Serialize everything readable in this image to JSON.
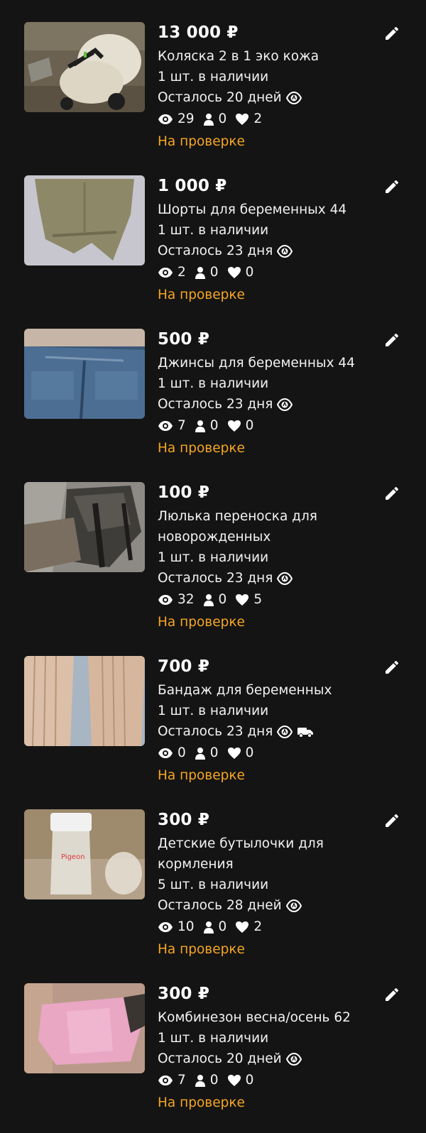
{
  "listings": [
    {
      "price": "13 000 ₽",
      "title": "Коляска 2 в 1 эко кожа",
      "title2": "",
      "stock": "1 шт. в наличии",
      "expires": "Осталось 20 дней",
      "views": "29",
      "contacts": "0",
      "favorites": "2",
      "status": "На проверке"
    },
    {
      "price": "1 000 ₽",
      "title": "Шорты для беременных 44",
      "title2": "",
      "stock": "1 шт. в наличии",
      "expires": "Осталось 23 дня",
      "views": "2",
      "contacts": "0",
      "favorites": "0",
      "status": "На проверке"
    },
    {
      "price": "500 ₽",
      "title": "Джинсы для беременных 44",
      "title2": "",
      "stock": "1 шт. в наличии",
      "expires": "Осталось 23 дня",
      "views": "7",
      "contacts": "0",
      "favorites": "0",
      "status": "На проверке"
    },
    {
      "price": "100 ₽",
      "title": "Люлька переноска для",
      "title2": "новорожденных",
      "stock": "1 шт. в наличии",
      "expires": "Осталось 23 дня",
      "views": "32",
      "contacts": "0",
      "favorites": "5",
      "status": "На проверке"
    },
    {
      "price": "700 ₽",
      "title": "Бандаж для беременных",
      "title2": "",
      "stock": "1 шт. в наличии",
      "expires": "Осталось 23 дня",
      "views": "0",
      "contacts": "0",
      "favorites": "0",
      "status": "На проверке"
    },
    {
      "price": "300 ₽",
      "title": "Детские бутылочки для",
      "title2": "кормления",
      "stock": "5 шт. в наличии",
      "expires": "Осталось 28 дней",
      "views": "10",
      "contacts": "0",
      "favorites": "2",
      "status": "На проверке",
      "brand_print": "Pigeon"
    },
    {
      "price": "300 ₽",
      "title": "Комбинезон весна/осень 62",
      "title2": "",
      "stock": "1 шт. в наличии",
      "expires": "Осталось 20 дней",
      "views": "7",
      "contacts": "0",
      "favorites": "0",
      "status": "На проверке"
    }
  ],
  "colors": {
    "background": "#141414",
    "text": "#ffffff",
    "status": "#f5a623"
  },
  "icons": {
    "edit": "pencil-icon",
    "expiry": "auto-renew-eye-icon",
    "delivery": "truck-icon",
    "views": "eye-icon",
    "contacts": "person-icon",
    "favorites": "heart-icon"
  }
}
